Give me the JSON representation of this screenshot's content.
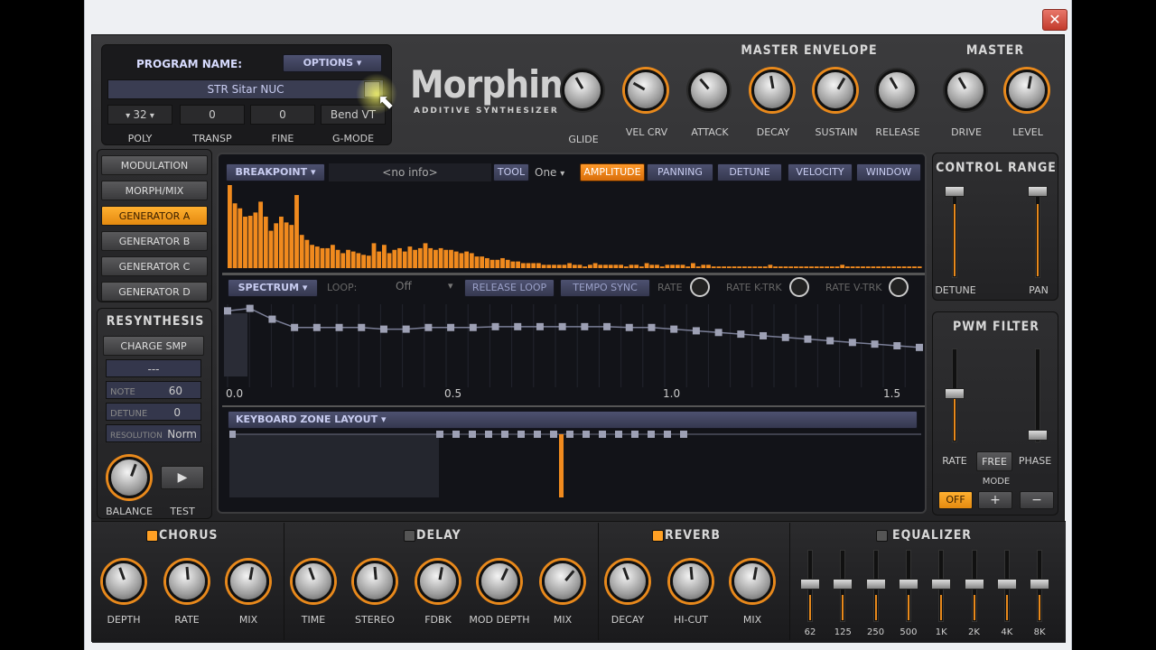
{
  "window": {
    "close_label": "✕"
  },
  "program": {
    "name_label": "PROGRAM NAME:",
    "options_label": "OPTIONS",
    "patch": "STR Sitar NUC",
    "poly": "32",
    "transp": "0",
    "fine": "0",
    "gmode": "Bend VT",
    "poly_label": "POLY",
    "transp_label": "TRANSP",
    "fine_label": "FINE",
    "gmode_label": "G-MODE"
  },
  "logo": {
    "name": "Morphine",
    "subtitle": "ADDITIVE SYNTHESIZER"
  },
  "master_envelope": {
    "title": "MASTER ENVELOPE",
    "knobs": [
      "GLIDE",
      "VEL CRV",
      "ATTACK",
      "DECAY",
      "SUSTAIN",
      "RELEASE"
    ]
  },
  "master": {
    "title": "MASTER",
    "knobs": [
      "DRIVE",
      "LEVEL"
    ]
  },
  "sidebar": {
    "items": [
      "MODULATION",
      "MORPH/MIX",
      "GENERATOR A",
      "GENERATOR B",
      "GENERATOR C",
      "GENERATOR D"
    ],
    "active": "GENERATOR A"
  },
  "resynthesis": {
    "title": "RESYNTHESIS",
    "charge": "CHARGE SMP",
    "sample": "---",
    "note_label": "NOTE",
    "note": "60",
    "detune_label": "DETUNE",
    "detune": "0",
    "resolution_label": "RESOLUTION",
    "resolution": "Norm",
    "balance_label": "BALANCE",
    "test_label": "TEST",
    "play_icon": "▶"
  },
  "editor": {
    "breakpoint_label": "BREAKPOINT",
    "info": "<no info>",
    "tool_label": "TOOL",
    "one_label": "One",
    "tabs": [
      "AMPLITUDE",
      "PANNING",
      "DETUNE",
      "VELOCITY",
      "WINDOW"
    ],
    "active_tab": "AMPLITUDE"
  },
  "spectrum": {
    "label": "SPECTRUM",
    "loop_label": "LOOP:",
    "loop_value": "Off",
    "release_loop": "RELEASE LOOP",
    "tempo_sync": "TEMPO SYNC",
    "rate": "RATE",
    "rate_ktrk": "RATE K-TRK",
    "rate_vtrk": "RATE V-TRK",
    "axis": [
      "0.0",
      "0.5",
      "1.0",
      "1.5"
    ]
  },
  "harmonics": [
    100,
    78,
    72,
    62,
    63,
    67,
    80,
    62,
    45,
    54,
    62,
    55,
    52,
    88,
    40,
    34,
    28,
    26,
    24,
    24,
    28,
    22,
    18,
    22,
    20,
    18,
    16,
    15,
    30,
    20,
    28,
    18,
    22,
    24,
    20,
    26,
    22,
    24,
    30,
    24,
    22,
    24,
    22,
    22,
    20,
    18,
    20,
    18,
    14,
    14,
    12,
    10,
    10,
    12,
    10,
    8,
    8,
    6,
    6,
    6,
    6,
    4,
    4,
    4,
    4,
    4,
    6,
    4,
    4,
    2,
    4,
    6,
    4,
    4,
    4,
    4,
    4,
    2,
    4,
    4,
    2,
    6,
    4,
    4,
    2,
    4,
    4,
    4,
    4,
    2,
    6,
    2,
    4,
    4,
    2,
    2,
    2,
    2,
    2,
    2,
    2,
    2,
    2,
    2,
    2,
    4,
    2,
    2,
    2,
    2,
    2,
    2,
    2,
    2,
    2,
    2,
    2,
    2,
    2,
    4,
    2,
    2,
    2,
    2,
    2,
    2,
    2,
    2,
    2,
    2,
    2,
    2,
    2,
    2,
    2
  ],
  "envelope_points": [
    [
      0.0,
      0.92
    ],
    [
      0.05,
      0.95
    ],
    [
      0.1,
      0.82
    ],
    [
      0.15,
      0.72
    ],
    [
      0.2,
      0.72
    ],
    [
      0.25,
      0.72
    ],
    [
      0.3,
      0.72
    ],
    [
      0.35,
      0.7
    ],
    [
      0.4,
      0.7
    ],
    [
      0.45,
      0.72
    ],
    [
      0.5,
      0.72
    ],
    [
      0.55,
      0.72
    ],
    [
      0.6,
      0.73
    ],
    [
      0.65,
      0.73
    ],
    [
      0.7,
      0.73
    ],
    [
      0.75,
      0.73
    ],
    [
      0.8,
      0.73
    ],
    [
      0.85,
      0.73
    ],
    [
      0.9,
      0.72
    ],
    [
      0.95,
      0.72
    ],
    [
      1.0,
      0.7
    ],
    [
      1.05,
      0.68
    ],
    [
      1.1,
      0.66
    ],
    [
      1.15,
      0.64
    ],
    [
      1.2,
      0.62
    ],
    [
      1.25,
      0.6
    ],
    [
      1.3,
      0.58
    ],
    [
      1.35,
      0.56
    ],
    [
      1.4,
      0.54
    ],
    [
      1.45,
      0.52
    ],
    [
      1.5,
      0.5
    ],
    [
      1.55,
      0.48
    ]
  ],
  "keyboard": {
    "label": "KEYBOARD ZONE LAYOUT"
  },
  "control_range": {
    "title": "CONTROL RANGE",
    "detune": "DETUNE",
    "pan": "PAN"
  },
  "pwm_filter": {
    "title": "PWM FILTER",
    "rate": "RATE",
    "free": "FREE",
    "phase": "PHASE",
    "mode": "MODE",
    "off": "OFF",
    "plus": "+",
    "minus": "−"
  },
  "effects": {
    "chorus": {
      "title": "CHORUS",
      "on": true,
      "knobs": [
        "DEPTH",
        "RATE",
        "MIX"
      ]
    },
    "delay": {
      "title": "DELAY",
      "on": false,
      "knobs": [
        "TIME",
        "STEREO",
        "FDBK",
        "MOD DEPTH",
        "MIX"
      ]
    },
    "reverb": {
      "title": "REVERB",
      "on": true,
      "knobs": [
        "DECAY",
        "HI-CUT",
        "MIX"
      ]
    },
    "equalizer": {
      "title": "EQUALIZER",
      "on": false,
      "bands": [
        "62",
        "125",
        "250",
        "500",
        "1K",
        "2K",
        "4K",
        "8K"
      ]
    }
  }
}
